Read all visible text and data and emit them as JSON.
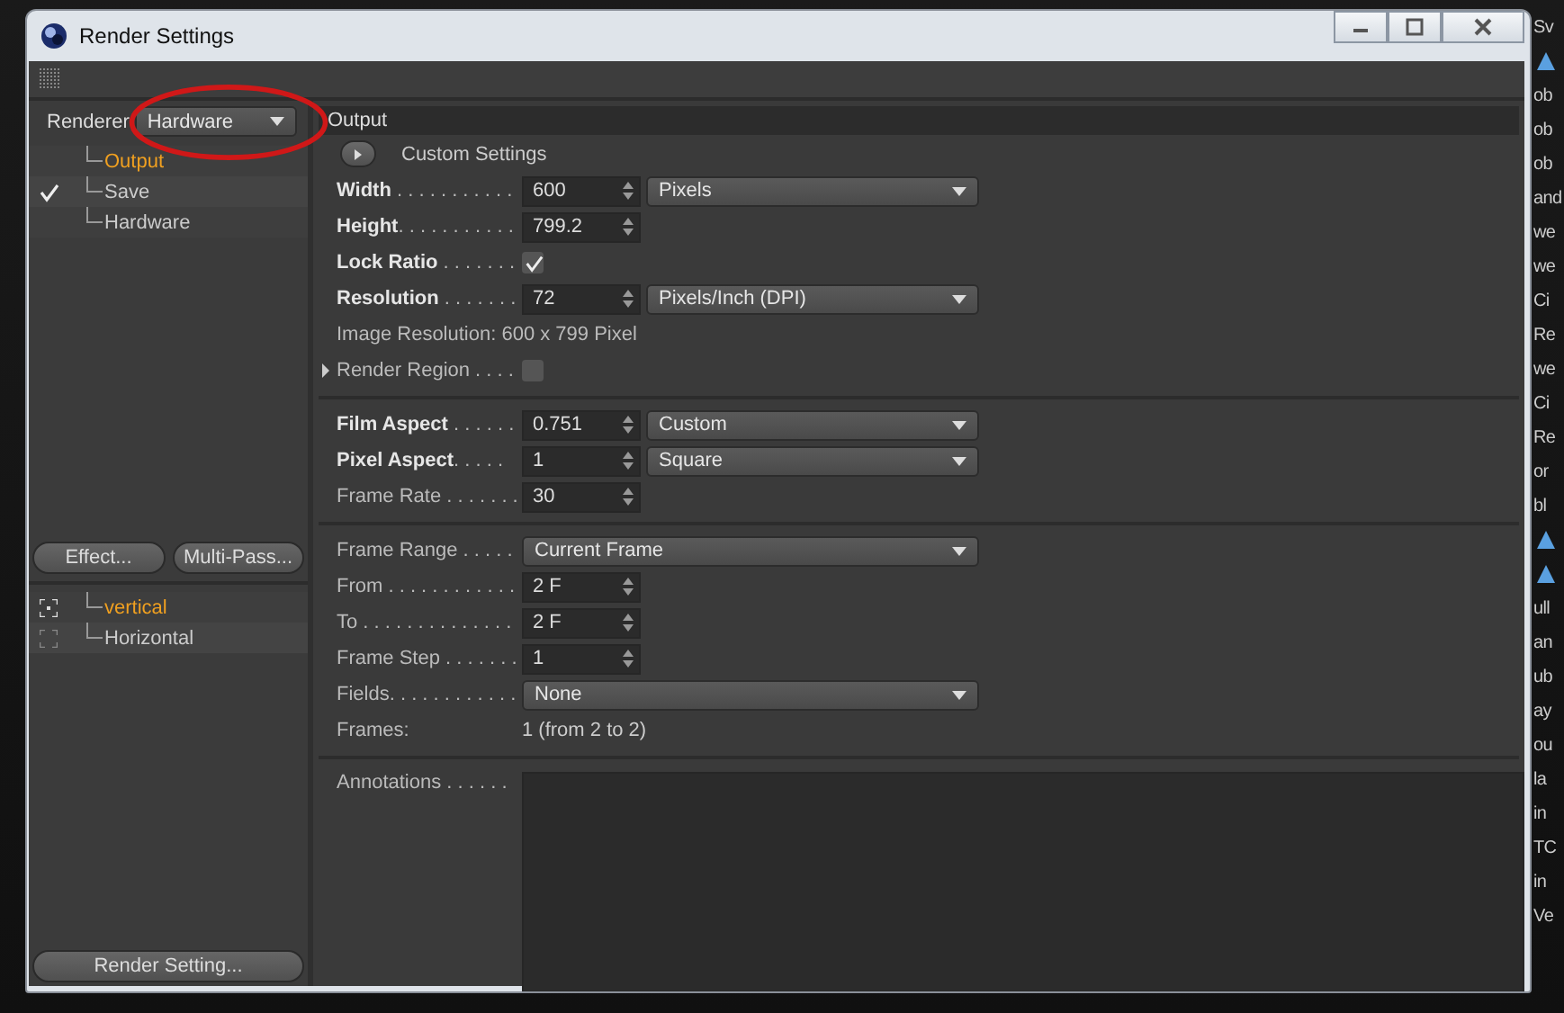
{
  "window": {
    "title": "Render Settings"
  },
  "renderer": {
    "label": "Renderer",
    "value": "Hardware",
    "circled": true
  },
  "nav": [
    {
      "label": "Output",
      "selected": true,
      "checked": false
    },
    {
      "label": "Save",
      "selected": false,
      "checked": true
    },
    {
      "label": "Hardware",
      "selected": false,
      "checked": false
    }
  ],
  "buttons": [
    "Effect...",
    "Multi-Pass..."
  ],
  "effects": [
    {
      "label": "vertical",
      "selected": true,
      "on": true
    },
    {
      "label": "Horizontal",
      "selected": false,
      "on": false
    }
  ],
  "footer_button": "Render Setting...",
  "panel": {
    "title": "Output",
    "custom_settings": "Custom Settings",
    "groups": [
      [
        {
          "kind": "field",
          "label": "**Width** . . . . . . . . . . .",
          "value": "600",
          "select": "Pixels"
        },
        {
          "kind": "field",
          "label": "**Height**. . . . . . . . . . .",
          "value": "799.2"
        },
        {
          "kind": "check",
          "label": "**Lock Ratio** . . . . . . .",
          "checked": true
        },
        {
          "kind": "field",
          "label": "**Resolution** . . . . . . .",
          "value": "72",
          "select": "Pixels/Inch (DPI)"
        },
        {
          "kind": "info",
          "text": "Image Resolution: 600 x 799 Pixel"
        },
        {
          "kind": "check",
          "label": "Render Region . . . .",
          "checked": false,
          "collapsed": true
        }
      ],
      [
        {
          "kind": "field",
          "label": "**Film Aspect** . . . . . .",
          "value": "0.751",
          "select": "Custom"
        },
        {
          "kind": "field",
          "label": "**Pixel Aspect**. . . . .",
          "value": "1",
          "select": "Square"
        },
        {
          "kind": "field",
          "label": "Frame Rate . . . . . . .",
          "value": "30"
        }
      ],
      [
        {
          "kind": "select",
          "label": "Frame Range . . . . .",
          "select": "Current Frame"
        },
        {
          "kind": "field",
          "label": "From . . . . . . . . . . . .",
          "value": "2 F"
        },
        {
          "kind": "field",
          "label": "To . . . . . . . . . . . . . .",
          "value": "2 F"
        },
        {
          "kind": "field",
          "label": "Frame Step . . . . . . .",
          "value": "1"
        },
        {
          "kind": "select",
          "label": "Fields. . . . . . . . . . . .",
          "select": "None"
        },
        {
          "kind": "pair",
          "label": "Frames:",
          "value": "1 (from 2 to 2)"
        }
      ],
      [
        {
          "kind": "textarea",
          "label": "Annotations . . . . . ."
        }
      ]
    ]
  },
  "background_fragments": [
    {
      "kind": "text",
      "text": "Sv"
    },
    {
      "kind": "icon"
    },
    {
      "kind": "text",
      "text": "ob"
    },
    {
      "kind": "text",
      "text": "ob"
    },
    {
      "kind": "text",
      "text": "ob"
    },
    {
      "kind": "text",
      "text": "and"
    },
    {
      "kind": "text",
      "text": "we"
    },
    {
      "kind": "text",
      "text": "we"
    },
    {
      "kind": "text",
      "text": "Ci"
    },
    {
      "kind": "text",
      "text": "Re"
    },
    {
      "kind": "text",
      "text": "we"
    },
    {
      "kind": "text",
      "text": "Ci"
    },
    {
      "kind": "text",
      "text": "Re"
    },
    {
      "kind": "text",
      "text": "or"
    },
    {
      "kind": "text",
      "text": "bl"
    },
    {
      "kind": "icon"
    },
    {
      "kind": "icon"
    },
    {
      "kind": "text",
      "text": "ull"
    },
    {
      "kind": "text",
      "text": "an"
    },
    {
      "kind": "text",
      "text": "ub"
    },
    {
      "kind": "text",
      "text": "ay"
    },
    {
      "kind": "text",
      "text": "ou"
    },
    {
      "kind": "text",
      "text": "la"
    },
    {
      "kind": "text",
      "text": "in"
    },
    {
      "kind": "text",
      "text": "TC"
    },
    {
      "kind": "text",
      "text": "in"
    },
    {
      "kind": "text",
      "text": "Ve"
    }
  ]
}
